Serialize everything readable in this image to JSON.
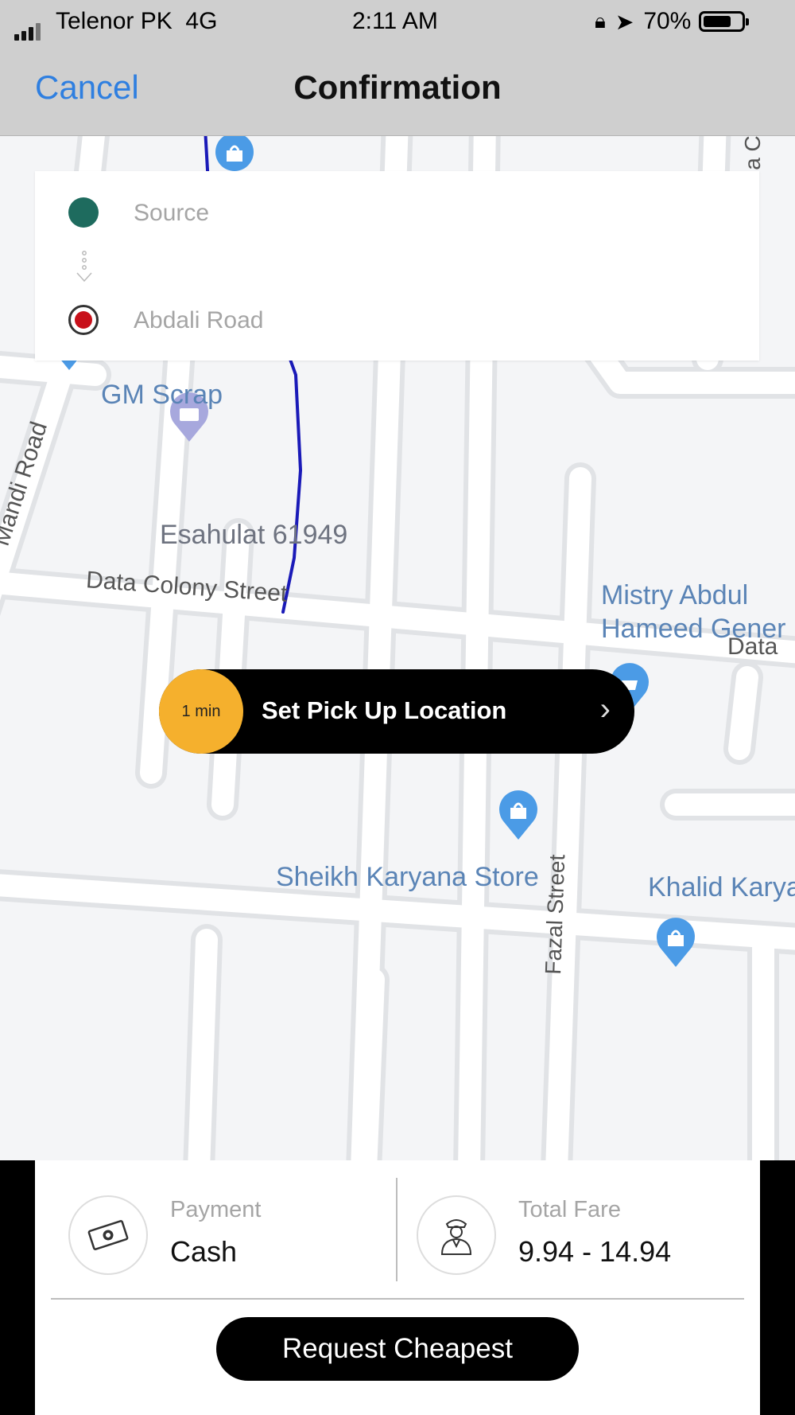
{
  "status_bar": {
    "carrier": "Telenor PK",
    "network": "4G",
    "time": "2:11 AM",
    "battery": "70%"
  },
  "nav": {
    "cancel_label": "Cancel",
    "title": "Confirmation"
  },
  "route": {
    "source_placeholder": "Source",
    "destination": "Abdali Road"
  },
  "map_labels": {
    "gm_scrap": "GM Scrap",
    "esahulat": "Esahulat 61949",
    "mandi_road": "Mandi Road",
    "data_colony_street": "Data Colony Street",
    "data_right": "Data",
    "mistry_line1": "Mistry Abdul",
    "mistry_line2": "Hameed Gener",
    "sheikh_karyana": "Sheikh Karyana Store",
    "fazal_street": "Fazal Street",
    "khalid_karya": "Khalid Karya",
    "edge_top": "a C"
  },
  "pickup": {
    "eta": "1 min",
    "label": "Set Pick Up Location"
  },
  "payment": {
    "label": "Payment",
    "value": "Cash"
  },
  "fare": {
    "label": "Total Fare",
    "value": "9.94 - 14.94"
  },
  "request_button": "Request Cheapest",
  "colors": {
    "accent_blue": "#2f7fe0",
    "route_line": "#1a1ab8",
    "source_dot": "#1e6b5e",
    "destination_dot": "#c8101a",
    "eta_badge": "#f5b02d",
    "poi_pin": "#4b9be6"
  }
}
